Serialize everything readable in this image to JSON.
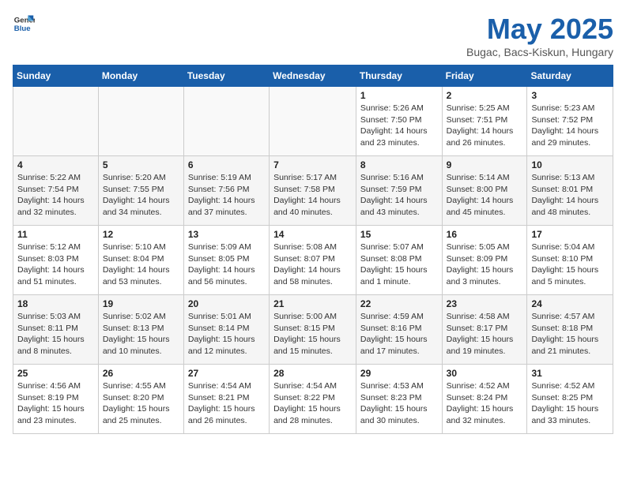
{
  "header": {
    "logo_general": "General",
    "logo_blue": "Blue",
    "month": "May 2025",
    "location": "Bugac, Bacs-Kiskun, Hungary"
  },
  "weekdays": [
    "Sunday",
    "Monday",
    "Tuesday",
    "Wednesday",
    "Thursday",
    "Friday",
    "Saturday"
  ],
  "weeks": [
    [
      {
        "day": "",
        "info": ""
      },
      {
        "day": "",
        "info": ""
      },
      {
        "day": "",
        "info": ""
      },
      {
        "day": "",
        "info": ""
      },
      {
        "day": "1",
        "info": "Sunrise: 5:26 AM\nSunset: 7:50 PM\nDaylight: 14 hours\nand 23 minutes."
      },
      {
        "day": "2",
        "info": "Sunrise: 5:25 AM\nSunset: 7:51 PM\nDaylight: 14 hours\nand 26 minutes."
      },
      {
        "day": "3",
        "info": "Sunrise: 5:23 AM\nSunset: 7:52 PM\nDaylight: 14 hours\nand 29 minutes."
      }
    ],
    [
      {
        "day": "4",
        "info": "Sunrise: 5:22 AM\nSunset: 7:54 PM\nDaylight: 14 hours\nand 32 minutes."
      },
      {
        "day": "5",
        "info": "Sunrise: 5:20 AM\nSunset: 7:55 PM\nDaylight: 14 hours\nand 34 minutes."
      },
      {
        "day": "6",
        "info": "Sunrise: 5:19 AM\nSunset: 7:56 PM\nDaylight: 14 hours\nand 37 minutes."
      },
      {
        "day": "7",
        "info": "Sunrise: 5:17 AM\nSunset: 7:58 PM\nDaylight: 14 hours\nand 40 minutes."
      },
      {
        "day": "8",
        "info": "Sunrise: 5:16 AM\nSunset: 7:59 PM\nDaylight: 14 hours\nand 43 minutes."
      },
      {
        "day": "9",
        "info": "Sunrise: 5:14 AM\nSunset: 8:00 PM\nDaylight: 14 hours\nand 45 minutes."
      },
      {
        "day": "10",
        "info": "Sunrise: 5:13 AM\nSunset: 8:01 PM\nDaylight: 14 hours\nand 48 minutes."
      }
    ],
    [
      {
        "day": "11",
        "info": "Sunrise: 5:12 AM\nSunset: 8:03 PM\nDaylight: 14 hours\nand 51 minutes."
      },
      {
        "day": "12",
        "info": "Sunrise: 5:10 AM\nSunset: 8:04 PM\nDaylight: 14 hours\nand 53 minutes."
      },
      {
        "day": "13",
        "info": "Sunrise: 5:09 AM\nSunset: 8:05 PM\nDaylight: 14 hours\nand 56 minutes."
      },
      {
        "day": "14",
        "info": "Sunrise: 5:08 AM\nSunset: 8:07 PM\nDaylight: 14 hours\nand 58 minutes."
      },
      {
        "day": "15",
        "info": "Sunrise: 5:07 AM\nSunset: 8:08 PM\nDaylight: 15 hours\nand 1 minute."
      },
      {
        "day": "16",
        "info": "Sunrise: 5:05 AM\nSunset: 8:09 PM\nDaylight: 15 hours\nand 3 minutes."
      },
      {
        "day": "17",
        "info": "Sunrise: 5:04 AM\nSunset: 8:10 PM\nDaylight: 15 hours\nand 5 minutes."
      }
    ],
    [
      {
        "day": "18",
        "info": "Sunrise: 5:03 AM\nSunset: 8:11 PM\nDaylight: 15 hours\nand 8 minutes."
      },
      {
        "day": "19",
        "info": "Sunrise: 5:02 AM\nSunset: 8:13 PM\nDaylight: 15 hours\nand 10 minutes."
      },
      {
        "day": "20",
        "info": "Sunrise: 5:01 AM\nSunset: 8:14 PM\nDaylight: 15 hours\nand 12 minutes."
      },
      {
        "day": "21",
        "info": "Sunrise: 5:00 AM\nSunset: 8:15 PM\nDaylight: 15 hours\nand 15 minutes."
      },
      {
        "day": "22",
        "info": "Sunrise: 4:59 AM\nSunset: 8:16 PM\nDaylight: 15 hours\nand 17 minutes."
      },
      {
        "day": "23",
        "info": "Sunrise: 4:58 AM\nSunset: 8:17 PM\nDaylight: 15 hours\nand 19 minutes."
      },
      {
        "day": "24",
        "info": "Sunrise: 4:57 AM\nSunset: 8:18 PM\nDaylight: 15 hours\nand 21 minutes."
      }
    ],
    [
      {
        "day": "25",
        "info": "Sunrise: 4:56 AM\nSunset: 8:19 PM\nDaylight: 15 hours\nand 23 minutes."
      },
      {
        "day": "26",
        "info": "Sunrise: 4:55 AM\nSunset: 8:20 PM\nDaylight: 15 hours\nand 25 minutes."
      },
      {
        "day": "27",
        "info": "Sunrise: 4:54 AM\nSunset: 8:21 PM\nDaylight: 15 hours\nand 26 minutes."
      },
      {
        "day": "28",
        "info": "Sunrise: 4:54 AM\nSunset: 8:22 PM\nDaylight: 15 hours\nand 28 minutes."
      },
      {
        "day": "29",
        "info": "Sunrise: 4:53 AM\nSunset: 8:23 PM\nDaylight: 15 hours\nand 30 minutes."
      },
      {
        "day": "30",
        "info": "Sunrise: 4:52 AM\nSunset: 8:24 PM\nDaylight: 15 hours\nand 32 minutes."
      },
      {
        "day": "31",
        "info": "Sunrise: 4:52 AM\nSunset: 8:25 PM\nDaylight: 15 hours\nand 33 minutes."
      }
    ]
  ]
}
